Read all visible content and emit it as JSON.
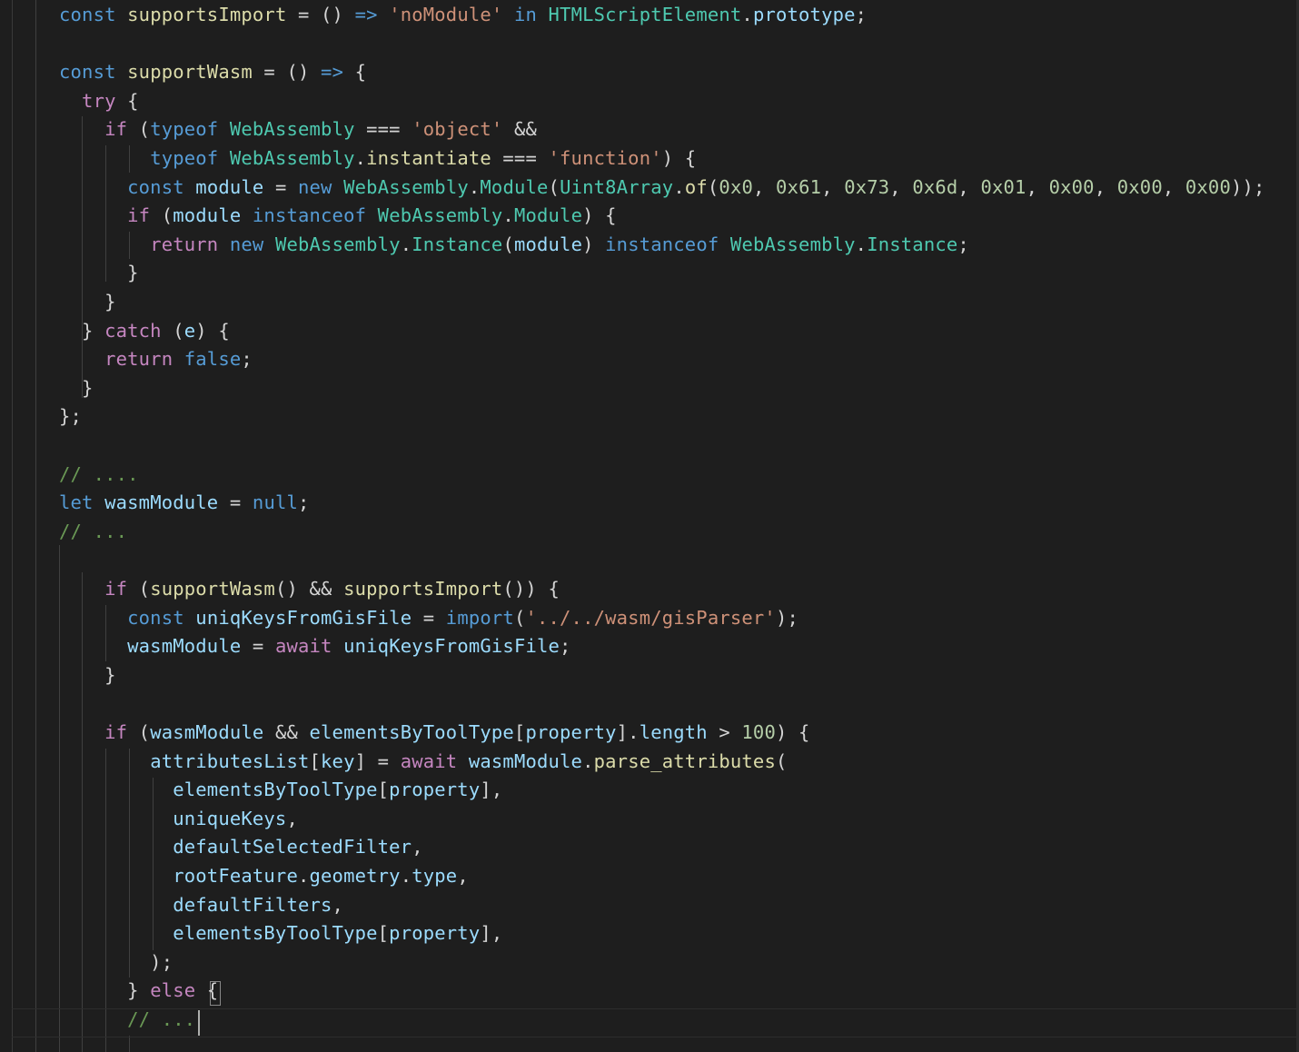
{
  "editor": {
    "colors": {
      "background": "#1e1e1e",
      "default": "#d4d4d4",
      "keyword": "#569cd6",
      "control": "#c586c0",
      "variable": "#9cdcfe",
      "function": "#dcdcaa",
      "type": "#4ec9b0",
      "string": "#ce9178",
      "number": "#b5cea8",
      "comment": "#6a9955"
    },
    "lines": [
      [
        [
          "const",
          "keyword"
        ],
        [
          " ",
          "default"
        ],
        [
          "supportsImport",
          "function"
        ],
        [
          " = () ",
          "default"
        ],
        [
          "=>",
          "keyword"
        ],
        [
          " ",
          "default"
        ],
        [
          "'noModule'",
          "string"
        ],
        [
          " ",
          "default"
        ],
        [
          "in",
          "keyword"
        ],
        [
          " ",
          "default"
        ],
        [
          "HTMLScriptElement",
          "type"
        ],
        [
          ".",
          "default"
        ],
        [
          "prototype",
          "variable"
        ],
        [
          ";",
          "default"
        ]
      ],
      [],
      [
        [
          "const",
          "keyword"
        ],
        [
          " ",
          "default"
        ],
        [
          "supportWasm",
          "function"
        ],
        [
          " = () ",
          "default"
        ],
        [
          "=>",
          "keyword"
        ],
        [
          " {",
          "default"
        ]
      ],
      [
        [
          "  ",
          "default"
        ],
        [
          "try",
          "control"
        ],
        [
          " {",
          "default"
        ]
      ],
      [
        [
          "    ",
          "default"
        ],
        [
          "if",
          "control"
        ],
        [
          " (",
          "default"
        ],
        [
          "typeof",
          "keyword"
        ],
        [
          " ",
          "default"
        ],
        [
          "WebAssembly",
          "type"
        ],
        [
          " === ",
          "default"
        ],
        [
          "'object'",
          "string"
        ],
        [
          " &&",
          "default"
        ]
      ],
      [
        [
          "        ",
          "default"
        ],
        [
          "typeof",
          "keyword"
        ],
        [
          " ",
          "default"
        ],
        [
          "WebAssembly",
          "type"
        ],
        [
          ".",
          "default"
        ],
        [
          "instantiate",
          "function"
        ],
        [
          " === ",
          "default"
        ],
        [
          "'function'",
          "string"
        ],
        [
          ") {",
          "default"
        ]
      ],
      [
        [
          "      ",
          "default"
        ],
        [
          "const",
          "keyword"
        ],
        [
          " ",
          "default"
        ],
        [
          "module",
          "variable"
        ],
        [
          " = ",
          "default"
        ],
        [
          "new",
          "keyword"
        ],
        [
          " ",
          "default"
        ],
        [
          "WebAssembly",
          "type"
        ],
        [
          ".",
          "default"
        ],
        [
          "Module",
          "type"
        ],
        [
          "(",
          "default"
        ],
        [
          "Uint8Array",
          "type"
        ],
        [
          ".",
          "default"
        ],
        [
          "of",
          "function"
        ],
        [
          "(",
          "default"
        ],
        [
          "0x0",
          "number"
        ],
        [
          ", ",
          "default"
        ],
        [
          "0x61",
          "number"
        ],
        [
          ", ",
          "default"
        ],
        [
          "0x73",
          "number"
        ],
        [
          ", ",
          "default"
        ],
        [
          "0x6d",
          "number"
        ],
        [
          ", ",
          "default"
        ],
        [
          "0x01",
          "number"
        ],
        [
          ", ",
          "default"
        ],
        [
          "0x00",
          "number"
        ],
        [
          ", ",
          "default"
        ],
        [
          "0x00",
          "number"
        ],
        [
          ", ",
          "default"
        ],
        [
          "0x00",
          "number"
        ],
        [
          "));",
          "default"
        ]
      ],
      [
        [
          "      ",
          "default"
        ],
        [
          "if",
          "control"
        ],
        [
          " (",
          "default"
        ],
        [
          "module",
          "variable"
        ],
        [
          " ",
          "default"
        ],
        [
          "instanceof",
          "keyword"
        ],
        [
          " ",
          "default"
        ],
        [
          "WebAssembly",
          "type"
        ],
        [
          ".",
          "default"
        ],
        [
          "Module",
          "type"
        ],
        [
          ") {",
          "default"
        ]
      ],
      [
        [
          "        ",
          "default"
        ],
        [
          "return",
          "control"
        ],
        [
          " ",
          "default"
        ],
        [
          "new",
          "keyword"
        ],
        [
          " ",
          "default"
        ],
        [
          "WebAssembly",
          "type"
        ],
        [
          ".",
          "default"
        ],
        [
          "Instance",
          "type"
        ],
        [
          "(",
          "default"
        ],
        [
          "module",
          "variable"
        ],
        [
          ") ",
          "default"
        ],
        [
          "instanceof",
          "keyword"
        ],
        [
          " ",
          "default"
        ],
        [
          "WebAssembly",
          "type"
        ],
        [
          ".",
          "default"
        ],
        [
          "Instance",
          "type"
        ],
        [
          ";",
          "default"
        ]
      ],
      [
        [
          "      }",
          "default"
        ]
      ],
      [
        [
          "    }",
          "default"
        ]
      ],
      [
        [
          "  } ",
          "default"
        ],
        [
          "catch",
          "control"
        ],
        [
          " (",
          "default"
        ],
        [
          "e",
          "variable"
        ],
        [
          ") {",
          "default"
        ]
      ],
      [
        [
          "    ",
          "default"
        ],
        [
          "return",
          "control"
        ],
        [
          " ",
          "default"
        ],
        [
          "false",
          "keyword"
        ],
        [
          ";",
          "default"
        ]
      ],
      [
        [
          "  }",
          "default"
        ]
      ],
      [
        [
          "};",
          "default"
        ]
      ],
      [],
      [
        [
          "// ....",
          "comment"
        ]
      ],
      [
        [
          "let",
          "keyword"
        ],
        [
          " ",
          "default"
        ],
        [
          "wasmModule",
          "variable"
        ],
        [
          " = ",
          "default"
        ],
        [
          "null",
          "keyword"
        ],
        [
          ";",
          "default"
        ]
      ],
      [
        [
          "// ...",
          "comment"
        ]
      ],
      [],
      [
        [
          "    ",
          "default"
        ],
        [
          "if",
          "control"
        ],
        [
          " (",
          "default"
        ],
        [
          "supportWasm",
          "function"
        ],
        [
          "() && ",
          "default"
        ],
        [
          "supportsImport",
          "function"
        ],
        [
          "()) {",
          "default"
        ]
      ],
      [
        [
          "      ",
          "default"
        ],
        [
          "const",
          "keyword"
        ],
        [
          " ",
          "default"
        ],
        [
          "uniqKeysFromGisFile",
          "variable"
        ],
        [
          " = ",
          "default"
        ],
        [
          "import",
          "keyword"
        ],
        [
          "(",
          "default"
        ],
        [
          "'../../wasm/gisParser'",
          "string"
        ],
        [
          ");",
          "default"
        ]
      ],
      [
        [
          "      ",
          "default"
        ],
        [
          "wasmModule",
          "variable"
        ],
        [
          " = ",
          "default"
        ],
        [
          "await",
          "control"
        ],
        [
          " ",
          "default"
        ],
        [
          "uniqKeysFromGisFile",
          "variable"
        ],
        [
          ";",
          "default"
        ]
      ],
      [
        [
          "    }",
          "default"
        ]
      ],
      [],
      [
        [
          "    ",
          "default"
        ],
        [
          "if",
          "control"
        ],
        [
          " (",
          "default"
        ],
        [
          "wasmModule",
          "variable"
        ],
        [
          " && ",
          "default"
        ],
        [
          "elementsByToolType",
          "variable"
        ],
        [
          "[",
          "default"
        ],
        [
          "property",
          "variable"
        ],
        [
          "].",
          "default"
        ],
        [
          "length",
          "variable"
        ],
        [
          " > ",
          "default"
        ],
        [
          "100",
          "number"
        ],
        [
          ") {",
          "default"
        ]
      ],
      [
        [
          "        ",
          "default"
        ],
        [
          "attributesList",
          "variable"
        ],
        [
          "[",
          "default"
        ],
        [
          "key",
          "variable"
        ],
        [
          "] = ",
          "default"
        ],
        [
          "await",
          "control"
        ],
        [
          " ",
          "default"
        ],
        [
          "wasmModule",
          "variable"
        ],
        [
          ".",
          "default"
        ],
        [
          "parse_attributes",
          "function"
        ],
        [
          "(",
          "default"
        ]
      ],
      [
        [
          "          ",
          "default"
        ],
        [
          "elementsByToolType",
          "variable"
        ],
        [
          "[",
          "default"
        ],
        [
          "property",
          "variable"
        ],
        [
          "],",
          "default"
        ]
      ],
      [
        [
          "          ",
          "default"
        ],
        [
          "uniqueKeys",
          "variable"
        ],
        [
          ",",
          "default"
        ]
      ],
      [
        [
          "          ",
          "default"
        ],
        [
          "defaultSelectedFilter",
          "variable"
        ],
        [
          ",",
          "default"
        ]
      ],
      [
        [
          "          ",
          "default"
        ],
        [
          "rootFeature",
          "variable"
        ],
        [
          ".",
          "default"
        ],
        [
          "geometry",
          "variable"
        ],
        [
          ".",
          "default"
        ],
        [
          "type",
          "variable"
        ],
        [
          ",",
          "default"
        ]
      ],
      [
        [
          "          ",
          "default"
        ],
        [
          "defaultFilters",
          "variable"
        ],
        [
          ",",
          "default"
        ]
      ],
      [
        [
          "          ",
          "default"
        ],
        [
          "elementsByToolType",
          "variable"
        ],
        [
          "[",
          "default"
        ],
        [
          "property",
          "variable"
        ],
        [
          "],",
          "default"
        ]
      ],
      [
        [
          "        );",
          "default"
        ]
      ],
      [
        [
          "      } ",
          "default"
        ],
        [
          "else",
          "control"
        ],
        [
          " {",
          "default"
        ]
      ],
      [
        [
          "      ",
          "default"
        ],
        [
          "// ...",
          "comment"
        ]
      ]
    ]
  }
}
